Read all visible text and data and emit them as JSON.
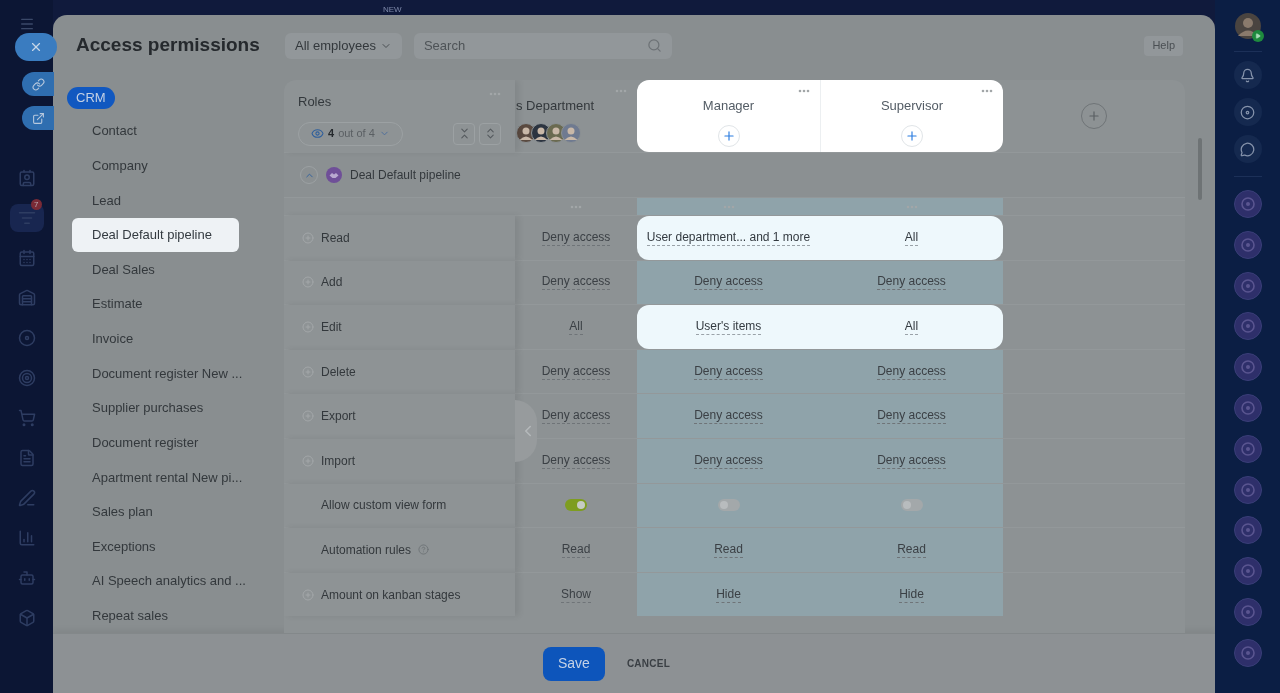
{
  "top_label": "NEW",
  "title": "Access permissions",
  "filter": "All employees",
  "search": {
    "placeholder": "Search"
  },
  "help": "Help",
  "notification_badge": "7",
  "category": {
    "label": "CRM",
    "selected": true
  },
  "nav_items": [
    {
      "label": "Contact",
      "selected": false
    },
    {
      "label": "Company",
      "selected": false
    },
    {
      "label": "Lead",
      "selected": false
    },
    {
      "label": "Deal Default pipeline",
      "selected": true
    },
    {
      "label": "Deal Sales",
      "selected": false
    },
    {
      "label": "Estimate",
      "selected": false
    },
    {
      "label": "Invoice",
      "selected": false
    },
    {
      "label": "Document register New ...",
      "selected": false
    },
    {
      "label": "Supplier purchases",
      "selected": false
    },
    {
      "label": "Document register",
      "selected": false
    },
    {
      "label": "Apartment rental New pi...",
      "selected": false
    },
    {
      "label": "Sales plan",
      "selected": false
    },
    {
      "label": "Exceptions",
      "selected": false
    },
    {
      "label": "AI Speech analytics and ...",
      "selected": false
    },
    {
      "label": "Repeat sales",
      "selected": false
    }
  ],
  "roles": {
    "title": "Roles",
    "shown": "4",
    "of": "out of 4"
  },
  "columns": [
    {
      "name": "s Department",
      "highlighted": false,
      "kind": "members"
    },
    {
      "name": "Manager",
      "highlighted": true,
      "kind": "add"
    },
    {
      "name": "Supervisor",
      "highlighted": true,
      "kind": "add"
    }
  ],
  "group": {
    "label": "Deal Default pipeline",
    "expanded": true
  },
  "rows": [
    {
      "label": "Read",
      "kind": "expandable",
      "highlighted": true,
      "cells": [
        {
          "value": "Deny access"
        },
        {
          "value": "User department... and 1 more"
        },
        {
          "value": "All"
        }
      ]
    },
    {
      "label": "Add",
      "kind": "expandable",
      "highlighted": false,
      "cells": [
        {
          "value": "Deny access"
        },
        {
          "value": "Deny access"
        },
        {
          "value": "Deny access"
        }
      ]
    },
    {
      "label": "Edit",
      "kind": "expandable",
      "highlighted": true,
      "cells": [
        {
          "value": "All"
        },
        {
          "value": "User's items"
        },
        {
          "value": "All"
        }
      ]
    },
    {
      "label": "Delete",
      "kind": "expandable",
      "highlighted": false,
      "cells": [
        {
          "value": "Deny access"
        },
        {
          "value": "Deny access"
        },
        {
          "value": "Deny access"
        }
      ]
    },
    {
      "label": "Export",
      "kind": "expandable",
      "highlighted": false,
      "cells": [
        {
          "value": "Deny access"
        },
        {
          "value": "Deny access"
        },
        {
          "value": "Deny access"
        }
      ]
    },
    {
      "label": "Import",
      "kind": "expandable",
      "highlighted": false,
      "cells": [
        {
          "value": "Deny access"
        },
        {
          "value": "Deny access"
        },
        {
          "value": "Deny access"
        }
      ]
    },
    {
      "label": "Allow custom view form",
      "kind": "toggle",
      "highlighted": false,
      "cells": [
        {
          "on": true
        },
        {
          "on": false
        },
        {
          "on": false
        }
      ]
    },
    {
      "label": "Automation rules",
      "kind": "help",
      "highlighted": false,
      "cells": [
        {
          "value": "Read"
        },
        {
          "value": "Read"
        },
        {
          "value": "Read"
        }
      ]
    },
    {
      "label": "Amount on kanban stages",
      "kind": "expandable",
      "highlighted": false,
      "cells": [
        {
          "value": "Show"
        },
        {
          "value": "Hide"
        },
        {
          "value": "Hide"
        }
      ]
    }
  ],
  "footer": {
    "save": "Save",
    "cancel": "CANCEL"
  }
}
